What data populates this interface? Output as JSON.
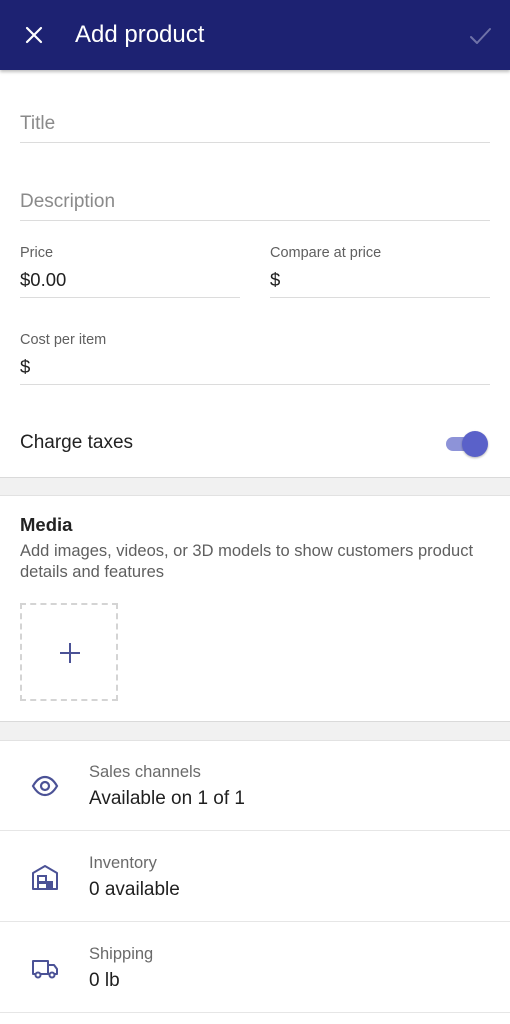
{
  "appbar": {
    "title": "Add product",
    "close_icon": "close-icon",
    "save_icon": "check-icon",
    "background": "#1d2272"
  },
  "fields": {
    "title_placeholder": "Title",
    "description_placeholder": "Description",
    "price_label": "Price",
    "price_value": "$0.00",
    "compare_label": "Compare at price",
    "compare_value": "$",
    "cost_label": "Cost per item",
    "cost_value": "$"
  },
  "charge_taxes": {
    "label": "Charge taxes",
    "enabled": true,
    "accent": "#5a61c9"
  },
  "media": {
    "title": "Media",
    "description": "Add images, videos, or 3D models to show customers product details and features",
    "add_icon": "plus-icon"
  },
  "rows": [
    {
      "icon": "eye-icon",
      "label": "Sales channels",
      "value": "Available on 1 of 1"
    },
    {
      "icon": "warehouse-icon",
      "label": "Inventory",
      "value": "0 available"
    },
    {
      "icon": "truck-icon",
      "label": "Shipping",
      "value": "0 lb"
    }
  ]
}
